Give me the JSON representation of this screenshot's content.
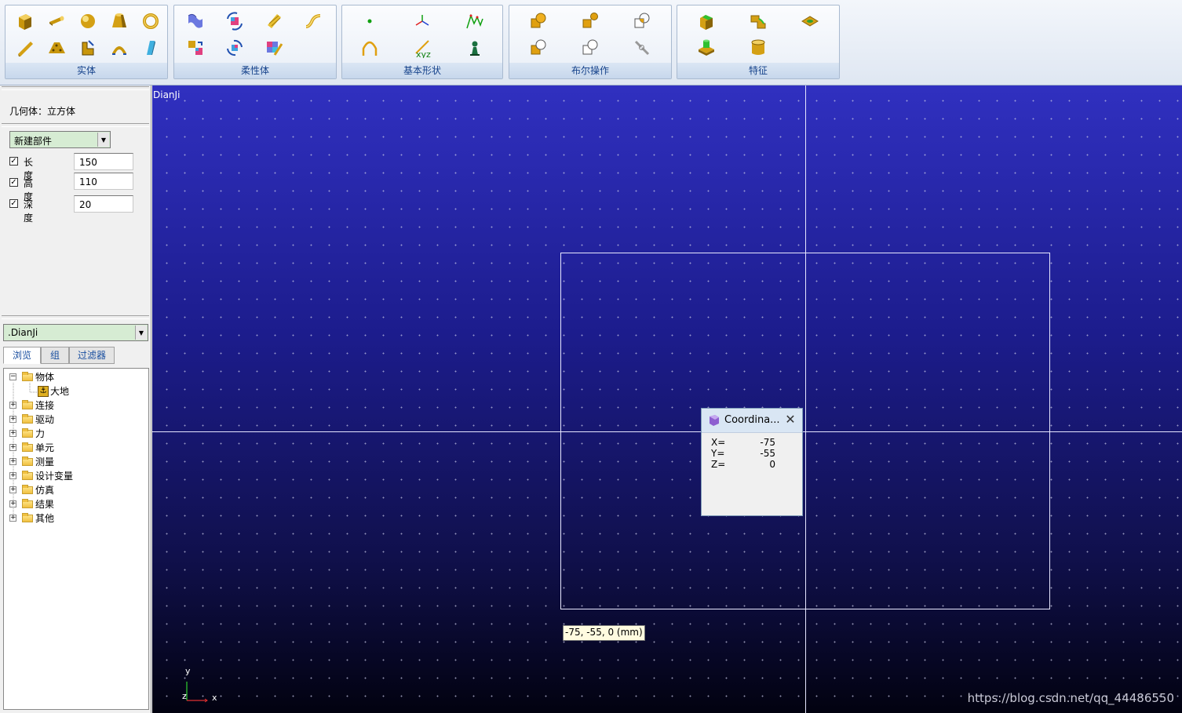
{
  "ribbon": {
    "groups": [
      {
        "label": "实体"
      },
      {
        "label": "柔性体"
      },
      {
        "label": "基本形状"
      },
      {
        "label": "布尔操作"
      },
      {
        "label": "特征"
      }
    ]
  },
  "left_panel": {
    "geometry_title": "几何体：立方体",
    "part_combo": "新建部件",
    "params": [
      {
        "label": "长度",
        "value": "150",
        "checked": true
      },
      {
        "label": "高度",
        "value": "110",
        "checked": true
      },
      {
        "label": "深度",
        "value": "20",
        "checked": true
      }
    ],
    "model_combo": ".DianJi",
    "tabs": [
      "浏览",
      "组",
      "过滤器"
    ],
    "tree": {
      "root": "物体",
      "child": "大地",
      "items": [
        "连接",
        "驱动",
        "力",
        "单元",
        "测量",
        "设计变量",
        "仿真",
        "结果",
        "其他"
      ]
    }
  },
  "viewport": {
    "name": "DianJi",
    "cursor_readout": "-75, -55, 0 (mm)",
    "axis_y": "y",
    "axis_z": "z",
    "axis_x": "x",
    "watermark": "https://blog.csdn.net/qq_44486550"
  },
  "coord_dialog": {
    "title": "Coordina...",
    "close": "✕",
    "rows": [
      {
        "label": "X=",
        "value": "-75"
      },
      {
        "label": "Y=",
        "value": "-55"
      },
      {
        "label": "Z=",
        "value": "0"
      }
    ]
  },
  "colors": {
    "viewport_top": "#3030c0",
    "viewport_bottom": "#020210",
    "combo_bg": "#d6ecd3",
    "ribbon_label": "#15428b"
  }
}
